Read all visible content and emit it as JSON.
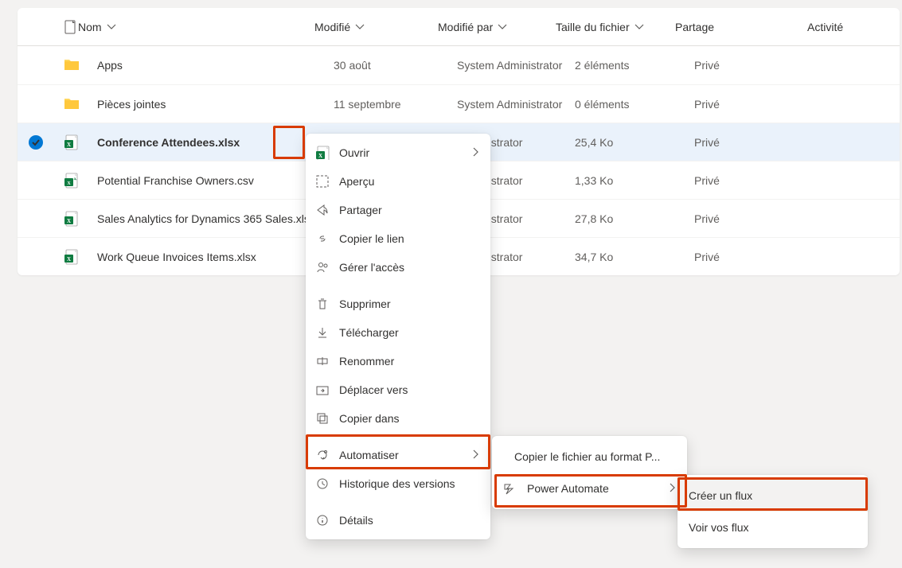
{
  "columns": {
    "name": "Nom",
    "modified": "Modifié",
    "modifiedBy": "Modifié par",
    "size": "Taille du fichier",
    "sharing": "Partage",
    "activity": "Activité"
  },
  "rows": [
    {
      "type": "folder",
      "name": "Apps",
      "modified": "30 août",
      "modifiedBy": "System Administrator",
      "size": "2 éléments",
      "sharing": "Privé",
      "selected": false
    },
    {
      "type": "folder",
      "name": "Pièces jointes",
      "modified": "11 septembre",
      "modifiedBy": "System Administrator",
      "size": "0 éléments",
      "sharing": "Privé",
      "selected": false
    },
    {
      "type": "xlsx",
      "name": "Conference Attendees.xlsx",
      "modified": "",
      "modifiedBy": "Administrator",
      "size": "25,4 Ko",
      "sharing": "Privé",
      "selected": true
    },
    {
      "type": "csv",
      "name": "Potential Franchise Owners.csv",
      "modified": "",
      "modifiedBy": "Administrator",
      "size": "1,33 Ko",
      "sharing": "Privé",
      "selected": false
    },
    {
      "type": "xlsx",
      "name": "Sales Analytics for Dynamics 365 Sales.xls",
      "modified": "",
      "modifiedBy": "Administrator",
      "size": "27,8 Ko",
      "sharing": "Privé",
      "selected": false
    },
    {
      "type": "xlsx",
      "name": "Work Queue Invoices Items.xlsx",
      "modified": "",
      "modifiedBy": "Administrator",
      "size": "34,7 Ko",
      "sharing": "Privé",
      "selected": false
    }
  ],
  "contextMenu": {
    "open": "Ouvrir",
    "preview": "Aperçu",
    "share": "Partager",
    "copyLink": "Copier le lien",
    "manageAccess": "Gérer l'accès",
    "delete": "Supprimer",
    "download": "Télécharger",
    "rename": "Renommer",
    "moveTo": "Déplacer vers",
    "copyTo": "Copier dans",
    "automate": "Automatiser",
    "versionHistory": "Historique des versions",
    "details": "Détails"
  },
  "automateSubmenu": {
    "copyAsPdf": "Copier le fichier au format P...",
    "powerAutomate": "Power Automate"
  },
  "powerAutomateSubmenu": {
    "createFlow": "Créer un flux",
    "seeFlows": "Voir vos flux"
  }
}
